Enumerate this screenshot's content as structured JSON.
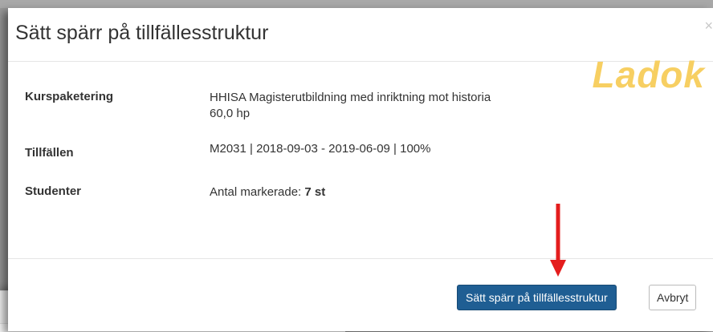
{
  "modal": {
    "title": "Sätt spärr på tillfällesstruktur",
    "close_glyph": "×",
    "watermark": "Ladok",
    "fields": {
      "kurspaketering": {
        "label": "Kurspaketering",
        "value_line1": "HHISA Magisterutbildning med inriktning mot historia",
        "value_line2": "60,0 hp"
      },
      "tillfallen": {
        "label": "Tillfällen",
        "value": "M2031 | 2018-09-03 - 2019-06-09 | 100%"
      },
      "studenter": {
        "label": "Studenter",
        "value_prefix": "Antal markerade: ",
        "value_strong": "7 st"
      }
    },
    "buttons": {
      "submit_label": "Sätt spärr på tillfällesstruktur",
      "cancel_label": "Avbryt"
    }
  },
  "colors": {
    "primary": "#1f5e93",
    "watermark": "#f7cf62",
    "arrow": "#e41d1d"
  },
  "icons": {
    "close": "close-icon",
    "annotation_arrow": "arrow-down-icon"
  }
}
